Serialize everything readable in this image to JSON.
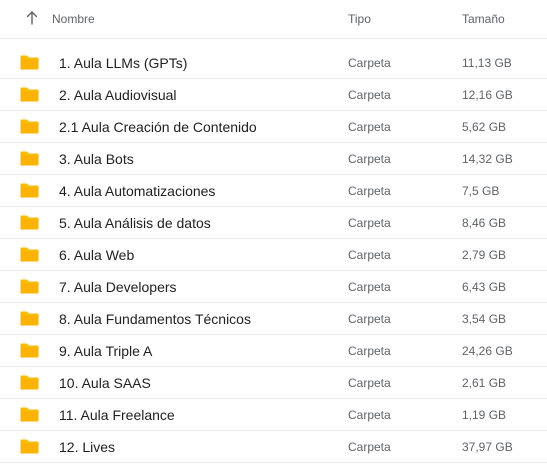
{
  "header": {
    "name": "Nombre",
    "type": "Tipo",
    "size": "Tamaño",
    "sort_icon": "arrow-up-icon"
  },
  "folder_color": "#FBBC04",
  "rows": [
    {
      "name": "1. Aula LLMs (GPTs)",
      "type": "Carpeta",
      "size": "11,13 GB",
      "icon": "folder-icon"
    },
    {
      "name": "2. Aula Audiovisual",
      "type": "Carpeta",
      "size": "12,16 GB",
      "icon": "folder-icon"
    },
    {
      "name": "2.1 Aula Creación de Contenido",
      "type": "Carpeta",
      "size": "5,62 GB",
      "icon": "folder-icon"
    },
    {
      "name": "3. Aula Bots",
      "type": "Carpeta",
      "size": "14,32 GB",
      "icon": "folder-icon"
    },
    {
      "name": "4. Aula Automatizaciones",
      "type": "Carpeta",
      "size": "7,5 GB",
      "icon": "folder-icon"
    },
    {
      "name": "5. Aula Análisis de datos",
      "type": "Carpeta",
      "size": "8,46 GB",
      "icon": "folder-icon"
    },
    {
      "name": "6. Aula Web",
      "type": "Carpeta",
      "size": "2,79 GB",
      "icon": "folder-icon"
    },
    {
      "name": "7. Aula Developers",
      "type": "Carpeta",
      "size": "6,43 GB",
      "icon": "folder-icon"
    },
    {
      "name": "8. Aula Fundamentos Técnicos",
      "type": "Carpeta",
      "size": "3,54 GB",
      "icon": "folder-icon"
    },
    {
      "name": "9. Aula Triple A",
      "type": "Carpeta",
      "size": "24,26 GB",
      "icon": "folder-icon"
    },
    {
      "name": "10. Aula SAAS",
      "type": "Carpeta",
      "size": "2,61 GB",
      "icon": "folder-icon"
    },
    {
      "name": "11. Aula Freelance",
      "type": "Carpeta",
      "size": "1,19 GB",
      "icon": "folder-icon"
    },
    {
      "name": "12. Lives",
      "type": "Carpeta",
      "size": "37,97 GB",
      "icon": "folder-icon"
    }
  ]
}
